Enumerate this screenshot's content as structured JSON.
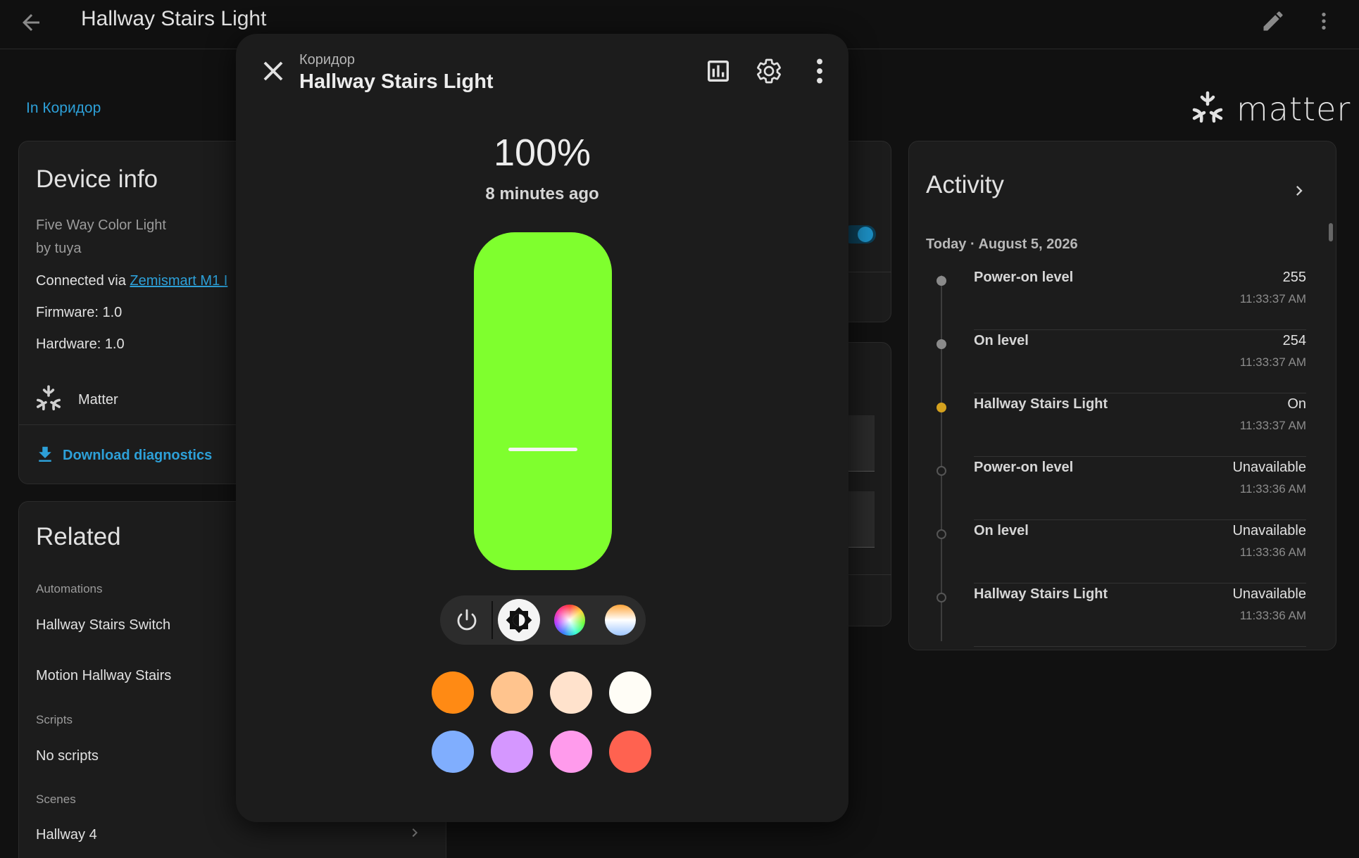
{
  "topbar": {
    "title": "Hallway Stairs Light"
  },
  "page": {
    "area_link": "In Коридор",
    "matter_logo_text": "matter"
  },
  "device_info": {
    "title": "Device info",
    "model": "Five Way Color Light",
    "manufacturer": "by tuya",
    "connected_via_prefix": "Connected via ",
    "connected_via_link": "Zemismart M1 I",
    "firmware": "Firmware: 1.0",
    "hardware": "Hardware: 1.0",
    "integration": "Matter",
    "download": "Download diagnostics"
  },
  "related": {
    "title": "Related",
    "automations_header": "Automations",
    "automations": [
      "Hallway Stairs Switch",
      "Motion Hallway Stairs"
    ],
    "scripts_header": "Scripts",
    "scripts_empty": "No scripts",
    "scenes_header": "Scenes",
    "scenes": [
      "Hallway 4"
    ]
  },
  "activity": {
    "title": "Activity",
    "date": "Today · August 5, 2026",
    "entries": [
      {
        "name": "Power-on level",
        "value": "255",
        "time": "11:33:37 AM",
        "dot": "filled",
        "color": "#8a8a8a"
      },
      {
        "name": "On level",
        "value": "254",
        "time": "11:33:37 AM",
        "dot": "filled",
        "color": "#8a8a8a"
      },
      {
        "name": "Hallway Stairs Light",
        "value": "On",
        "time": "11:33:37 AM",
        "dot": "filled",
        "color": "#d4a11e"
      },
      {
        "name": "Power-on level",
        "value": "Unavailable",
        "time": "11:33:36 AM",
        "dot": "hollow",
        "color": "#555555"
      },
      {
        "name": "On level",
        "value": "Unavailable",
        "time": "11:33:36 AM",
        "dot": "hollow",
        "color": "#555555"
      },
      {
        "name": "Hallway Stairs Light",
        "value": "Unavailable",
        "time": "11:33:36 AM",
        "dot": "hollow",
        "color": "#555555"
      }
    ]
  },
  "dialog": {
    "area": "Коридор",
    "title": "Hallway Stairs Light",
    "state": "100%",
    "last_changed": "8 minutes ago",
    "brightness_percent": 100,
    "light_color": "#7fff2e",
    "modes": [
      {
        "icon": "power-icon",
        "selected": false
      },
      {
        "icon": "brightness-icon",
        "selected": true
      },
      {
        "icon": "color-wheel-icon",
        "selected": false
      },
      {
        "icon": "color-temperature-icon",
        "selected": false
      }
    ],
    "favorite_colors": [
      "#ff8a14",
      "#ffc48e",
      "#ffe2cc",
      "#fffdf6",
      "#80aefe",
      "#d597ff",
      "#ff9bec",
      "#ff6250"
    ]
  },
  "colors": {
    "accent": "#2da0d8",
    "background": "#111111",
    "card": "#1c1c1c"
  }
}
